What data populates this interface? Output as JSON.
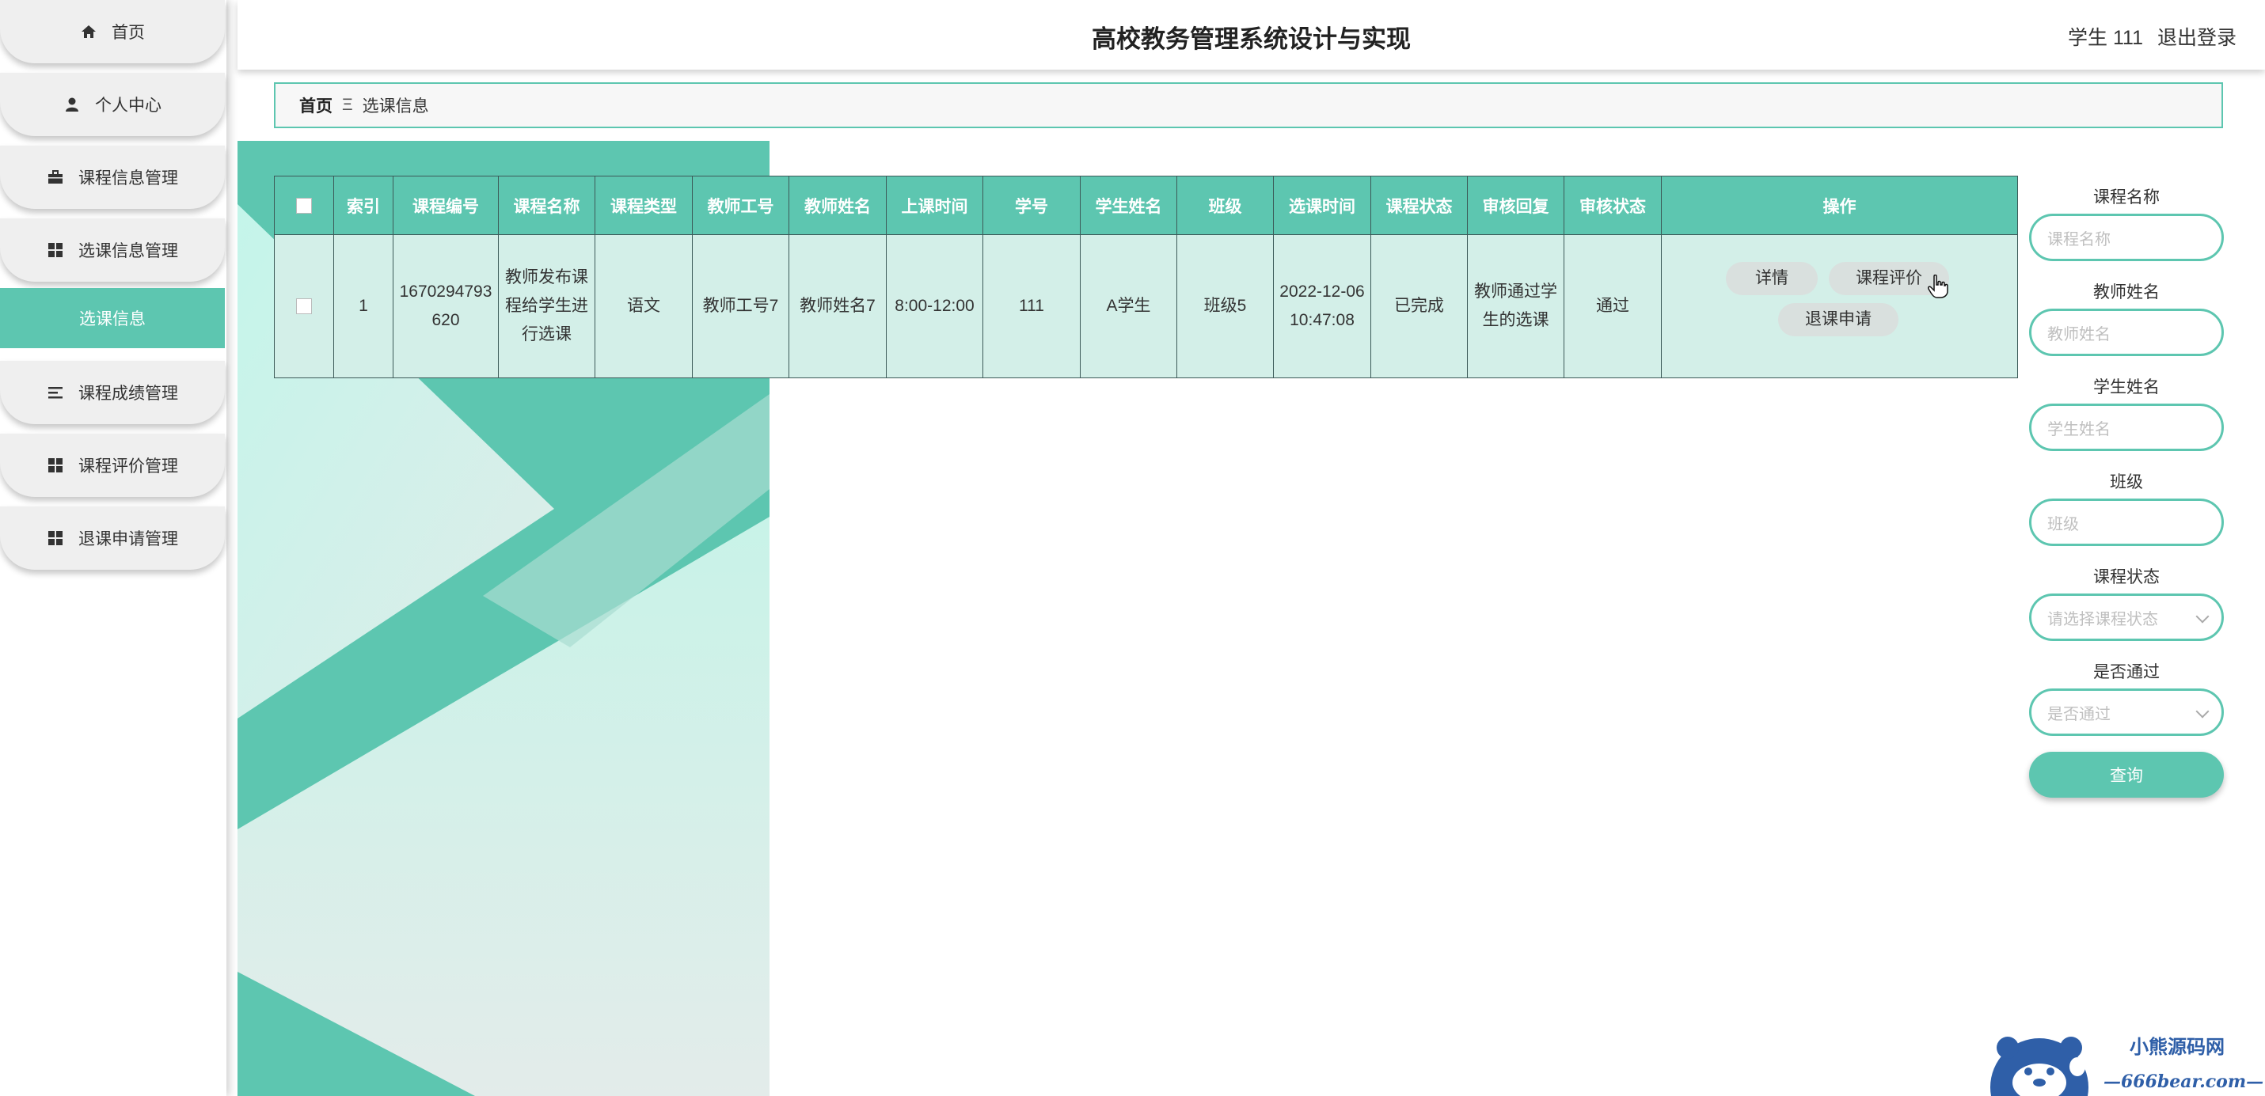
{
  "app": {
    "title": "高校教务管理系统设计与实现",
    "user_label": "学生 111",
    "logout_label": "退出登录"
  },
  "sidebar": {
    "items": [
      {
        "label": "首页",
        "icon": "home-icon"
      },
      {
        "label": "个人中心",
        "icon": "person-icon"
      },
      {
        "label": "课程信息管理",
        "icon": "briefcase-icon"
      },
      {
        "label": "选课信息管理",
        "icon": "grid-icon"
      },
      {
        "label": "选课信息",
        "icon": ""
      },
      {
        "label": "课程成绩管理",
        "icon": "list-icon"
      },
      {
        "label": "课程评价管理",
        "icon": "grid-icon"
      },
      {
        "label": "退课申请管理",
        "icon": "grid-icon"
      }
    ]
  },
  "breadcrumb": {
    "home": "首页",
    "separator": "Ξ",
    "current": "选课信息"
  },
  "table": {
    "headers": [
      "索引",
      "课程编号",
      "课程名称",
      "课程类型",
      "教师工号",
      "教师姓名",
      "上课时间",
      "学号",
      "学生姓名",
      "班级",
      "选课时间",
      "课程状态",
      "审核回复",
      "审核状态",
      "操作"
    ],
    "rows": [
      {
        "index": "1",
        "course_no": "1670294793620",
        "course_name": "教师发布课程给学生进行选课",
        "course_type": "语文",
        "teacher_no": "教师工号7",
        "teacher_name": "教师姓名7",
        "class_time": "8:00-12:00",
        "student_no": "111",
        "student_name": "A学生",
        "class": "班级5",
        "select_time": "2022-12-06 10:47:08",
        "course_status": "已完成",
        "review_reply": "教师通过学生的选课",
        "review_status": "通过"
      }
    ],
    "actions": {
      "detail": "详情",
      "evaluate": "课程评价",
      "withdraw": "退课申请"
    }
  },
  "search": {
    "course_name_label": "课程名称",
    "course_name_placeholder": "课程名称",
    "teacher_name_label": "教师姓名",
    "teacher_name_placeholder": "教师姓名",
    "student_name_label": "学生姓名",
    "student_name_placeholder": "学生姓名",
    "class_label": "班级",
    "class_placeholder": "班级",
    "status_label": "课程状态",
    "status_placeholder": "请选择课程状态",
    "pass_label": "是否通过",
    "pass_placeholder": "是否通过",
    "query_label": "查询"
  },
  "watermark": {
    "name": "小熊源码网",
    "url": "—666bear.com—"
  },
  "colors": {
    "accent": "#5dc6b0",
    "row_bg": "#d3efe8"
  }
}
